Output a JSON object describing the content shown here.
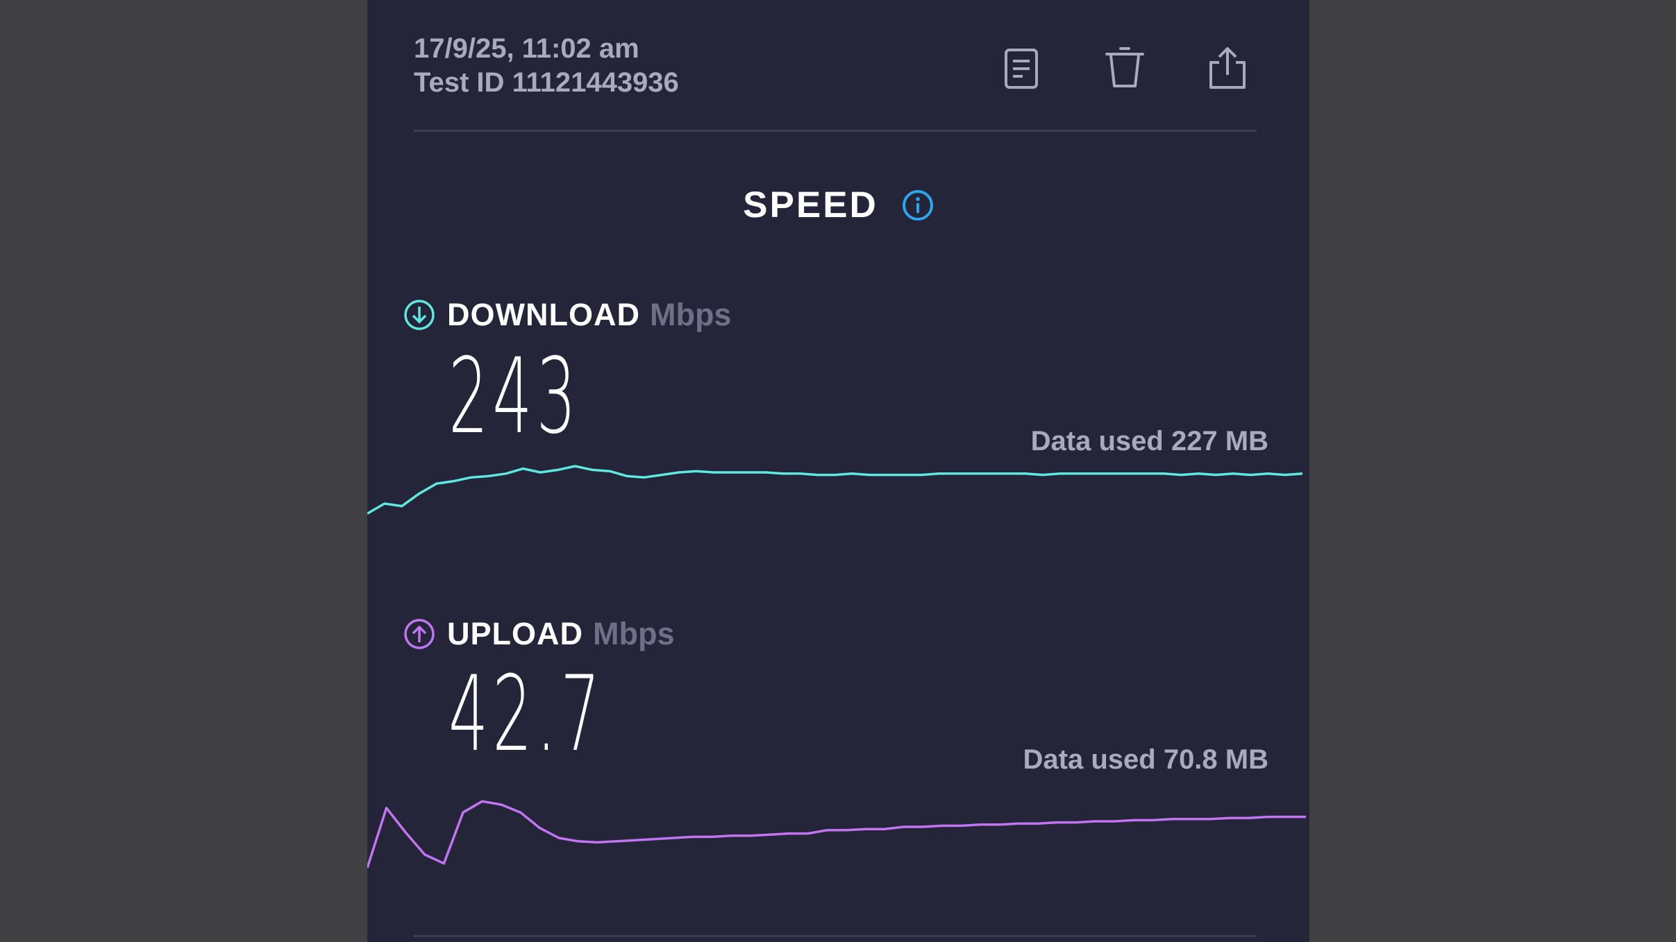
{
  "header": {
    "date": "17/9/25, 11:02 am",
    "test_id": "Test ID 11121443936"
  },
  "toolbar": {
    "icons": [
      "document-icon",
      "trash-icon",
      "share-icon"
    ]
  },
  "speed": {
    "title": "SPEED"
  },
  "download": {
    "label": "DOWNLOAD",
    "unit": "Mbps",
    "value": "243",
    "data_used": "Data used 227 MB",
    "color": "#5ee9e0",
    "trace": [
      0.38,
      0.3,
      0.32,
      0.22,
      0.14,
      0.12,
      0.09,
      0.08,
      0.06,
      0.02,
      0.05,
      0.03,
      0.0,
      0.03,
      0.04,
      0.08,
      0.09,
      0.07,
      0.05,
      0.04,
      0.05,
      0.05,
      0.05,
      0.05,
      0.06,
      0.06,
      0.07,
      0.07,
      0.06,
      0.07,
      0.07,
      0.07,
      0.07,
      0.06,
      0.06,
      0.06,
      0.06,
      0.06,
      0.06,
      0.07,
      0.06,
      0.06,
      0.06,
      0.06,
      0.06,
      0.06,
      0.06,
      0.07,
      0.06,
      0.07,
      0.06,
      0.07,
      0.06,
      0.07,
      0.06
    ]
  },
  "upload": {
    "label": "UPLOAD",
    "unit": "Mbps",
    "value": "42.7",
    "data_used": "Data used 70.8 MB",
    "color": "#c274f2",
    "trace": [
      0.62,
      0.08,
      0.3,
      0.5,
      0.58,
      0.12,
      0.02,
      0.05,
      0.12,
      0.26,
      0.35,
      0.38,
      0.39,
      0.38,
      0.37,
      0.36,
      0.35,
      0.34,
      0.34,
      0.33,
      0.33,
      0.32,
      0.31,
      0.31,
      0.28,
      0.28,
      0.27,
      0.27,
      0.25,
      0.25,
      0.24,
      0.24,
      0.23,
      0.23,
      0.22,
      0.22,
      0.21,
      0.21,
      0.2,
      0.2,
      0.19,
      0.19,
      0.18,
      0.18,
      0.18,
      0.17,
      0.17,
      0.16,
      0.16,
      0.16
    ]
  }
}
